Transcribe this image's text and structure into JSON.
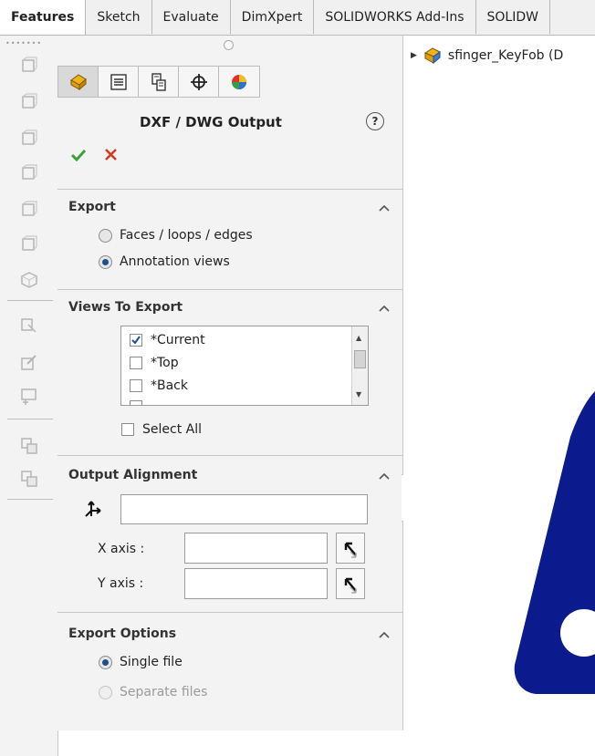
{
  "tabs": [
    "Features",
    "Sketch",
    "Evaluate",
    "DimXpert",
    "SOLIDWORKS Add-Ins",
    "SOLIDW"
  ],
  "property_manager": {
    "title": "DXF / DWG Output",
    "help_glyph": "?",
    "tab_icons": [
      "feature-manager-icon",
      "property-manager-icon",
      "configuration-manager-icon",
      "dimxpert-manager-icon",
      "display-manager-icon"
    ],
    "export": {
      "label": "Export",
      "options": [
        "Faces / loops / edges",
        "Annotation views"
      ],
      "selected": "Annotation views"
    },
    "views_to_export": {
      "label": "Views To Export",
      "items": [
        {
          "label": "*Current",
          "checked": true
        },
        {
          "label": "*Top",
          "checked": false
        },
        {
          "label": "*Back",
          "checked": false
        }
      ],
      "select_all": "Select All"
    },
    "output_alignment": {
      "label": "Output Alignment",
      "x_axis": "X axis :",
      "y_axis": "Y axis :"
    },
    "export_options": {
      "label": "Export Options",
      "single": "Single file",
      "separate": "Separate files"
    }
  },
  "tree": {
    "item": "sfinger_KeyFob  (D"
  },
  "colors": {
    "part_fill": "#0b1a8c",
    "accept": "#3aa336",
    "cancel": "#d23a1f"
  }
}
